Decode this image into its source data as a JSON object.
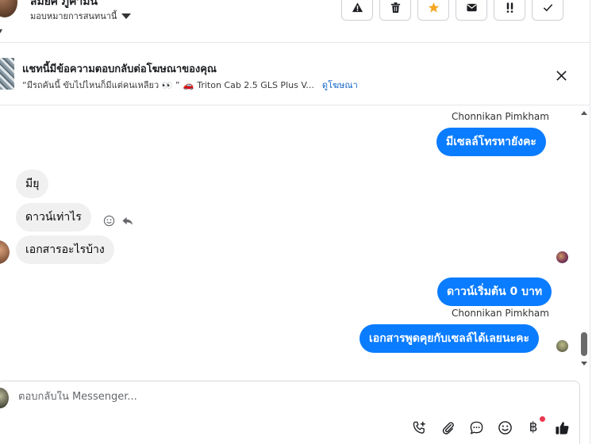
{
  "header": {
    "contact_name": "สมยศ ภูคำมั่น",
    "assign_label": "มอบหมายการสนทนานี้",
    "actions": [
      {
        "name": "report-spam",
        "icon": "warning-icon"
      },
      {
        "name": "delete",
        "icon": "trash-icon"
      },
      {
        "name": "follow-up",
        "icon": "star-icon"
      },
      {
        "name": "mark-unread",
        "icon": "envelope-icon"
      },
      {
        "name": "priority",
        "icon": "double-exclamation-icon"
      },
      {
        "name": "mark-done",
        "icon": "check-icon"
      }
    ]
  },
  "ad_banner": {
    "title": "แชทนี้มีข้อความตอบกลับต่อโฆษณาของคุณ",
    "quote": "“มีรถคันนี้ ขับไปไหนก็มีแต่คนเหลียว 👀 ”",
    "car_emoji": "🚗",
    "ad_name": "Triton Cab 2.5 GLS Plus V...",
    "view_ad_link": "ดูโฆษณา"
  },
  "conversation": {
    "messages": [
      {
        "direction": "sender_label",
        "text": "Chonnikan Pimkham"
      },
      {
        "direction": "outgoing",
        "text": "มีเซลล์โทรหายังคะ"
      },
      {
        "direction": "incoming",
        "text": "มียุ"
      },
      {
        "direction": "incoming",
        "text": "ดาวน์เท่าไร"
      },
      {
        "direction": "incoming",
        "text": "เอกสารอะไรบ้าง"
      },
      {
        "direction": "outgoing",
        "text": "ดาวน์เริ่มต้น 0 บาท"
      },
      {
        "direction": "sender_label",
        "text": "Chonnikan Pimkham"
      },
      {
        "direction": "outgoing",
        "text": "เอกสารพูดคุยกับเซลล์ได้เลยนะคะ"
      }
    ]
  },
  "composer": {
    "placeholder": "ตอบกลับใน Messenger...",
    "tools": [
      "call-add-icon",
      "paperclip-icon",
      "saved-reply-icon",
      "emoji-icon",
      "payment-icon",
      "thumbs-up-icon"
    ],
    "payment_symbol": "฿"
  },
  "colors": {
    "outgoing_bubble": "#0a7cff",
    "incoming_bubble": "#f0f0f0",
    "link": "#1366c8",
    "star": "#f5a623"
  }
}
